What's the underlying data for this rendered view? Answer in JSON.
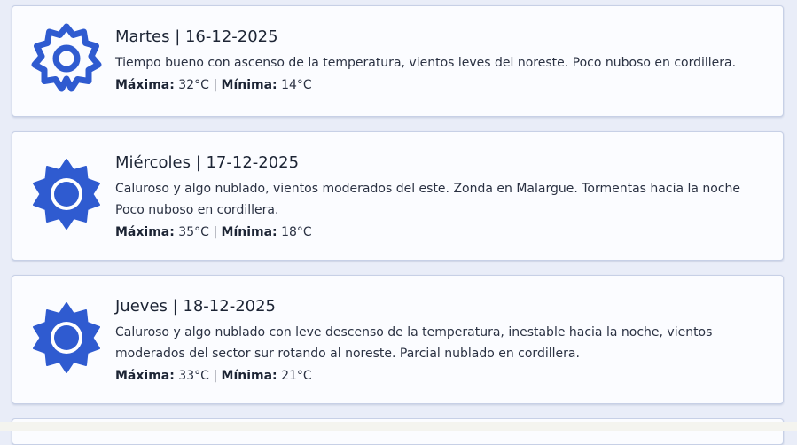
{
  "forecast": {
    "days": [
      {
        "title": "Martes | 16-12-2025",
        "description": "Tiempo bueno con ascenso de la temperatura, vientos leves del noreste. Poco nuboso en cordillera.",
        "max_label": "Máxima:",
        "max_value": "32°C",
        "separator": "|",
        "min_label": "Mínima:",
        "min_value": "14°C",
        "icon": "sun-outline-icon"
      },
      {
        "title": "Miércoles | 17-12-2025",
        "description": "Caluroso y algo nublado, vientos moderados del este. Zonda en Malargue. Tormentas hacia la noche Poco nuboso en cordillera.",
        "max_label": "Máxima:",
        "max_value": "35°C",
        "separator": "|",
        "min_label": "Mínima:",
        "min_value": "18°C",
        "icon": "sun-filled-icon"
      },
      {
        "title": "Jueves | 18-12-2025",
        "description": "Caluroso y algo nublado con leve descenso de la temperatura, inestable hacia la noche, vientos moderados del sector sur rotando al noreste. Parcial nublado en cordillera.",
        "max_label": "Máxima:",
        "max_value": "33°C",
        "separator": "|",
        "min_label": "Mínima:",
        "min_value": "21°C",
        "icon": "sun-filled-icon"
      }
    ]
  },
  "colors": {
    "icon_blue": "#2f5bd0",
    "background": "#e9edf8",
    "card": "#fbfcff"
  }
}
